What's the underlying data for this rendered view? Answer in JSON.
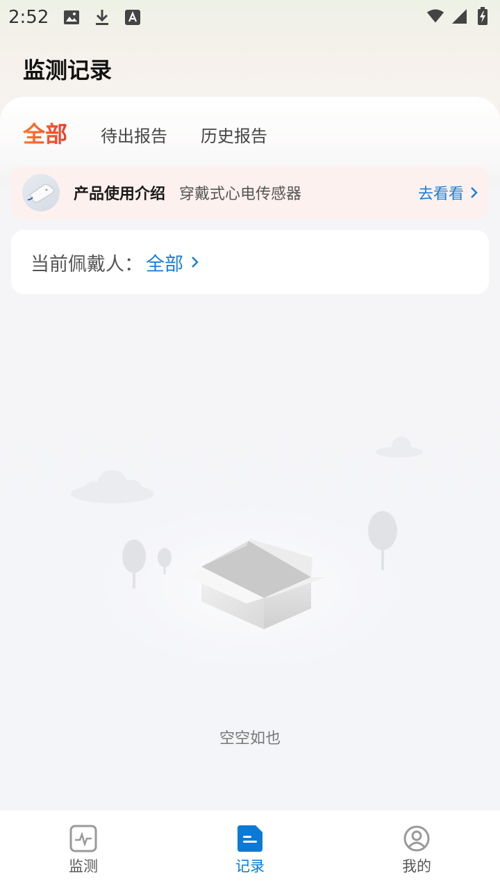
{
  "status_bar": {
    "time": "2:52"
  },
  "header": {
    "title": "监测记录"
  },
  "tabs": [
    {
      "label": "全部",
      "active": true
    },
    {
      "label": "待出报告",
      "active": false
    },
    {
      "label": "历史报告",
      "active": false
    }
  ],
  "banner": {
    "title": "产品使用介绍",
    "subtitle": "穿戴式心电传感器",
    "link": "去看看"
  },
  "wearer": {
    "label": "当前佩戴人：",
    "value": "全部"
  },
  "empty_state": {
    "text": "空空如也"
  },
  "bottom_nav": [
    {
      "label": "监测",
      "icon": "heartbeat-icon",
      "active": false
    },
    {
      "label": "记录",
      "icon": "record-icon",
      "active": true
    },
    {
      "label": "我的",
      "icon": "profile-icon",
      "active": false
    }
  ],
  "colors": {
    "accent_blue": "#1a7fd6",
    "tab_active": "#f25b2a",
    "banner_bg": "#fdf1ef"
  }
}
